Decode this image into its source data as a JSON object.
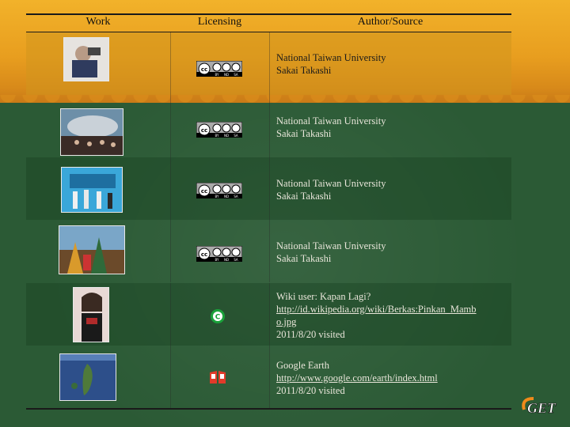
{
  "headers": {
    "work": "Work",
    "licensing": "Licensing",
    "author": "Author/Source"
  },
  "rows": [
    {
      "license_type": "cc-by-nd-sa",
      "author_lines": [
        "National Taiwan University",
        "Sakai Takashi"
      ]
    },
    {
      "license_type": "cc-by-nd-sa",
      "author_lines": [
        "National Taiwan University",
        "Sakai Takashi"
      ]
    },
    {
      "license_type": "cc-by-nd-sa",
      "author_lines": [
        "National Taiwan University",
        "Sakai Takashi"
      ]
    },
    {
      "license_type": "cc-by-nd-sa",
      "author_lines": [
        "National Taiwan University",
        "Sakai Takashi"
      ]
    },
    {
      "license_type": "copyright",
      "author_lines": [
        "Wiki user: Kapan Lagi?"
      ],
      "link_lines": [
        "http://id.wikipedia.org/wiki/Berkas:Pinkan_Mamb",
        "o.jpg"
      ],
      "visited": "2011/8/20 visited"
    },
    {
      "license_type": "fair-use",
      "author_lines": [
        "Google Earth"
      ],
      "link_lines": [
        "http://www.google.com/earth/index.html"
      ],
      "visited": "2011/8/20 visited"
    }
  ],
  "cc_badge": {
    "cc": "cc",
    "by": "BY",
    "nd": "ND",
    "sa": "SA"
  },
  "copyright_symbol": "C",
  "logo_text": "GET",
  "colors": {
    "background": "#2b5a35",
    "top_band": "#f2b22a",
    "text_light": "#e9e6da",
    "text_dark": "#111111"
  }
}
